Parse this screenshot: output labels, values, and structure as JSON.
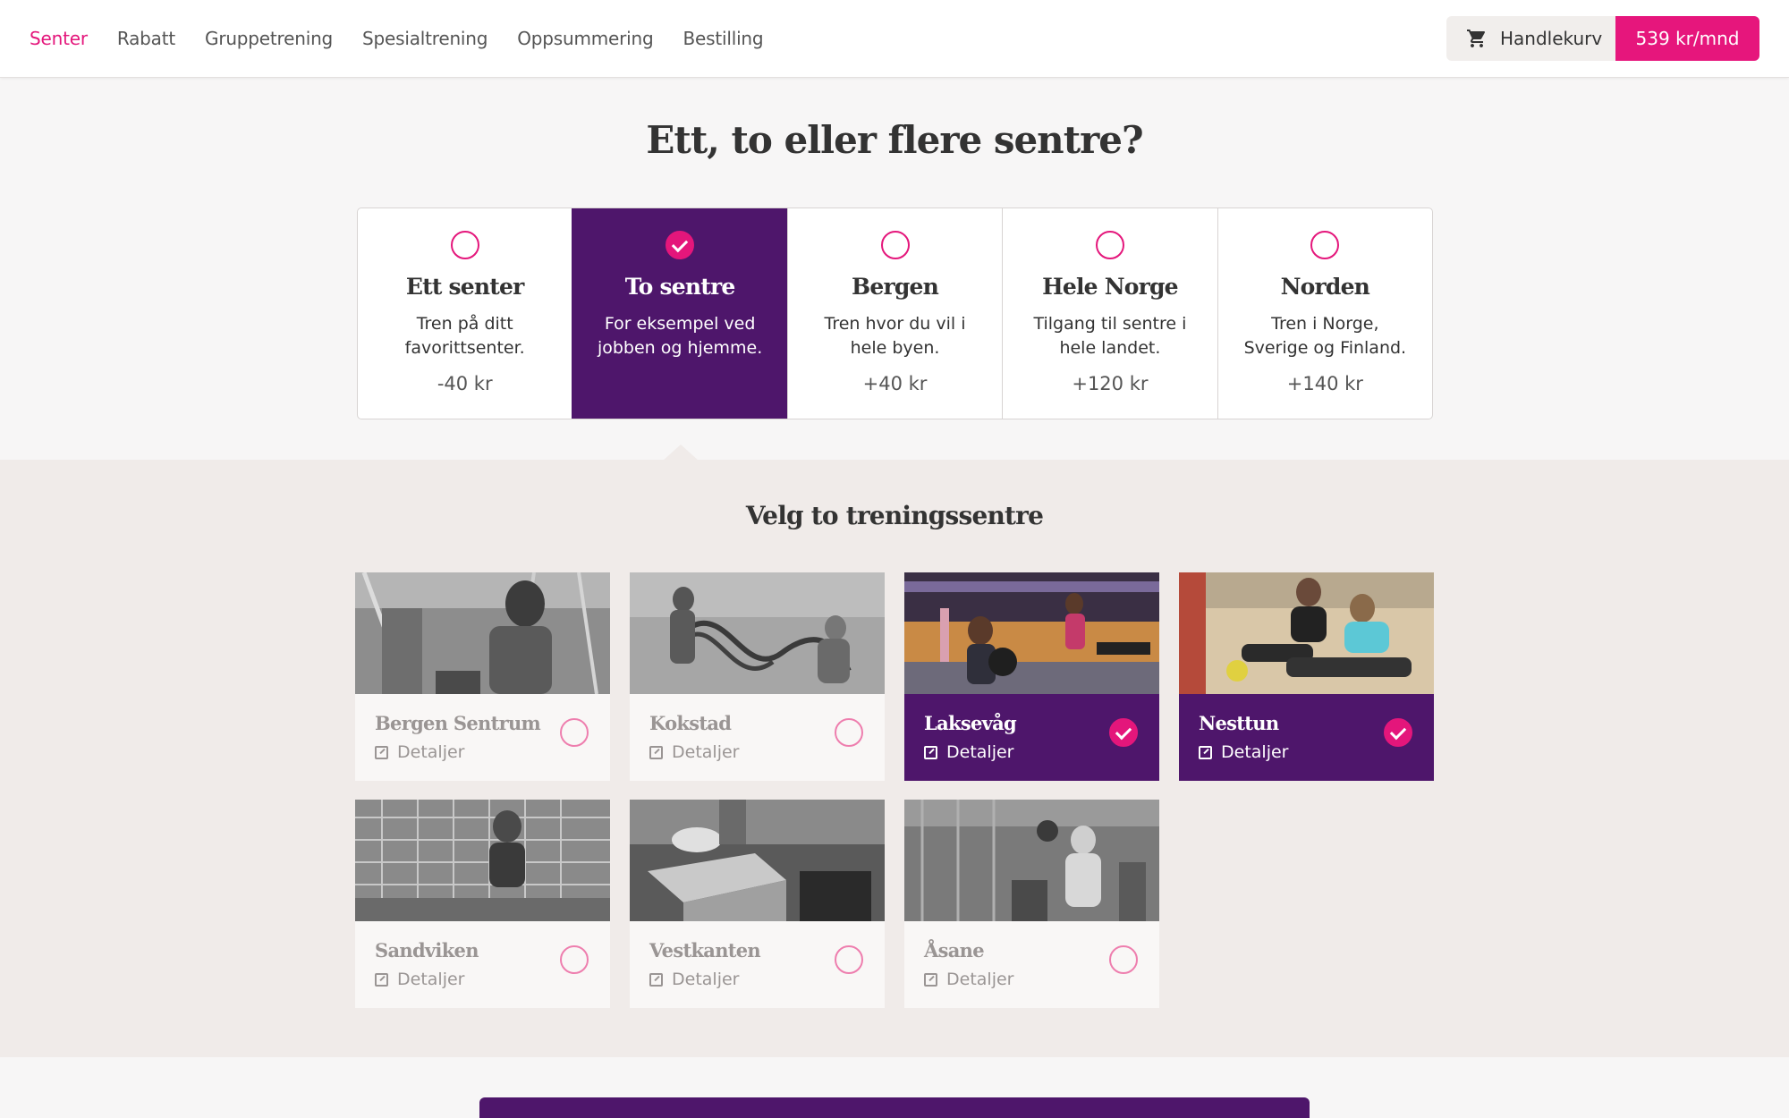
{
  "nav": {
    "items": [
      "Senter",
      "Rabatt",
      "Gruppetrening",
      "Spesialtrening",
      "Oppsummering",
      "Bestilling"
    ],
    "active": "Senter"
  },
  "cart": {
    "label": "Handlekurv",
    "price": "539 kr/mnd",
    "icon": "cart-icon"
  },
  "title": "Ett, to eller flere sentre?",
  "options": [
    {
      "name": "Ett senter",
      "desc": "Tren på ditt favorittsenter.",
      "delta": "-40 kr",
      "selected": false
    },
    {
      "name": "To sentre",
      "desc": "For eksempel ved jobben og hjemme.",
      "delta": "",
      "selected": true
    },
    {
      "name": "Bergen",
      "desc": "Tren hvor du vil i hele byen.",
      "delta": "+40 kr",
      "selected": false
    },
    {
      "name": "Hele Norge",
      "desc": "Tilgang til sentre i hele landet.",
      "delta": "+120 kr",
      "selected": false
    },
    {
      "name": "Norden",
      "desc": "Tren i Norge, Sverige og Finland.",
      "delta": "+140 kr",
      "selected": false
    }
  ],
  "subtitle": "Velg to treningssentre",
  "details_label": "Detaljer",
  "centers": [
    {
      "name": "Bergen Sentrum",
      "selected": false
    },
    {
      "name": "Kokstad",
      "selected": false
    },
    {
      "name": "Laksevåg",
      "selected": true
    },
    {
      "name": "Nesttun",
      "selected": true
    },
    {
      "name": "Sandviken",
      "selected": false
    },
    {
      "name": "Vestkanten",
      "selected": false
    },
    {
      "name": "Åsane",
      "selected": false
    }
  ],
  "colors": {
    "accent": "#e4167b",
    "selected_bg": "#4e166b"
  }
}
